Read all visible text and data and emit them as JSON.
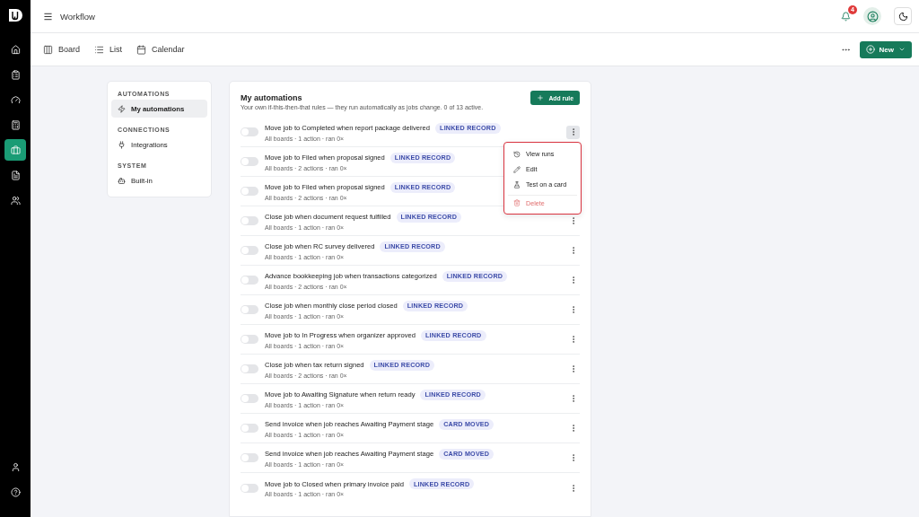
{
  "app": {
    "title": "Workflow",
    "notifications": "4"
  },
  "rail": [
    {
      "selected": false
    },
    {
      "selected": false
    },
    {
      "selected": false
    },
    {
      "selected": false
    },
    {
      "selected": true
    },
    {
      "selected": false
    },
    {
      "selected": false
    }
  ],
  "views": [
    {
      "label": "Board"
    },
    {
      "label": "List"
    },
    {
      "label": "Calendar"
    }
  ],
  "new_button": {
    "label": "New"
  },
  "settings_nav": [
    {
      "heading": "AUTOMATIONS",
      "items": [
        {
          "label": "My automations",
          "selected": true
        }
      ]
    },
    {
      "heading": "CONNECTIONS",
      "items": [
        {
          "label": "Integrations",
          "selected": false
        }
      ]
    },
    {
      "heading": "SYSTEM",
      "items": [
        {
          "label": "Built-in",
          "selected": false
        }
      ]
    }
  ],
  "automations": {
    "title": "My automations",
    "subtitle": "Your own if-this-then-that rules — they run automatically as jobs change. 0 of 13 active.",
    "add_button": "Add rule",
    "rules": [
      {
        "name": "Move job to Completed when report package delivered",
        "badge": "LINKED RECORD",
        "meta": "All boards · 1 action · ran 0×",
        "on": false,
        "menu_open": true
      },
      {
        "name": "Move job to Filed when proposal signed",
        "badge": "LINKED RECORD",
        "meta": "All boards · 2 actions · ran 0×",
        "on": false,
        "menu_open": false
      },
      {
        "name": "Move job to Filed when proposal signed",
        "badge": "LINKED RECORD",
        "meta": "All boards · 2 actions · ran 0×",
        "on": false,
        "menu_open": false
      },
      {
        "name": "Close job when document request fulfilled",
        "badge": "LINKED RECORD",
        "meta": "All boards · 1 action · ran 0×",
        "on": false,
        "menu_open": false
      },
      {
        "name": "Close job when RC survey delivered",
        "badge": "LINKED RECORD",
        "meta": "All boards · 1 action · ran 0×",
        "on": false,
        "menu_open": false
      },
      {
        "name": "Advance bookkeeping job when transactions categorized",
        "badge": "LINKED RECORD",
        "meta": "All boards · 2 actions · ran 0×",
        "on": false,
        "menu_open": false
      },
      {
        "name": "Close job when monthly close period closed",
        "badge": "LINKED RECORD",
        "meta": "All boards · 1 action · ran 0×",
        "on": false,
        "menu_open": false
      },
      {
        "name": "Move job to In Progress when organizer approved",
        "badge": "LINKED RECORD",
        "meta": "All boards · 1 action · ran 0×",
        "on": false,
        "menu_open": false
      },
      {
        "name": "Close job when tax return signed",
        "badge": "LINKED RECORD",
        "meta": "All boards · 2 actions · ran 0×",
        "on": false,
        "menu_open": false
      },
      {
        "name": "Move job to Awaiting Signature when return ready",
        "badge": "LINKED RECORD",
        "meta": "All boards · 1 action · ran 0×",
        "on": false,
        "menu_open": false
      },
      {
        "name": "Send invoice when job reaches Awaiting Payment stage",
        "badge": "CARD MOVED",
        "meta": "All boards · 1 action · ran 0×",
        "on": false,
        "menu_open": false
      },
      {
        "name": "Send invoice when job reaches Awaiting Payment stage",
        "badge": "CARD MOVED",
        "meta": "All boards · 1 action · ran 0×",
        "on": false,
        "menu_open": false
      },
      {
        "name": "Move job to Closed when primary invoice paid",
        "badge": "LINKED RECORD",
        "meta": "All boards · 1 action · ran 0×",
        "on": false,
        "menu_open": false
      }
    ]
  },
  "context_menu": [
    {
      "label": "View runs",
      "kind": "normal"
    },
    {
      "label": "Edit",
      "kind": "normal"
    },
    {
      "label": "Test on a card",
      "kind": "normal"
    },
    {
      "label": "Delete",
      "kind": "danger"
    }
  ]
}
